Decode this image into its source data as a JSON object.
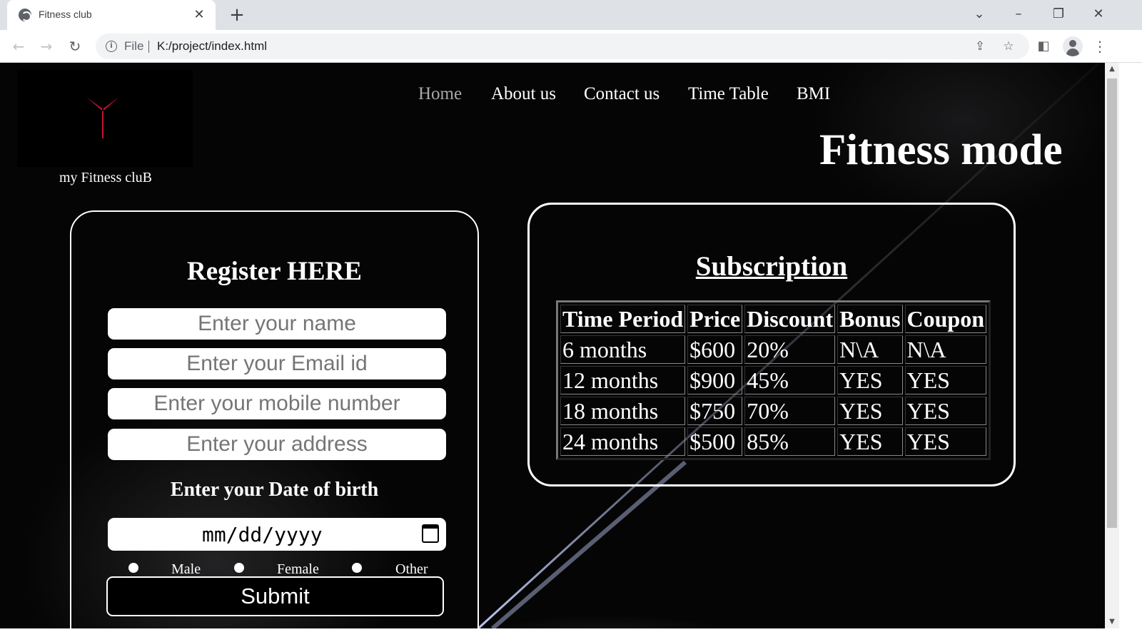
{
  "browser": {
    "tab_title": "Fitness club",
    "tab_close": "✕",
    "new_tab": "+",
    "url_scheme": "File",
    "url": "K:/project/index.html",
    "icons": [
      "globe-icon",
      "back-icon",
      "forward-icon",
      "reload-icon",
      "info-icon",
      "share-icon",
      "star-icon",
      "side-panel-icon",
      "profile-icon",
      "menu-icon"
    ]
  },
  "site": {
    "tagline": "my Fitness cluB",
    "nav": [
      "Home",
      "About us",
      "Contact us",
      "Time Table",
      "BMI"
    ],
    "active_nav": "Home",
    "hero_title": "Fitness mode"
  },
  "register": {
    "heading": "Register HERE",
    "name_placeholder": "Enter your name",
    "email_placeholder": "Enter your Email id",
    "mobile_placeholder": "Enter your mobile number",
    "address_placeholder": "Enter your address",
    "dob_label": "Enter your Date of birth",
    "dob_placeholder": "mm/dd/yyyy",
    "gender_options": [
      "Male",
      "Female",
      "Other"
    ],
    "submit_label": "Submit"
  },
  "subscription": {
    "heading": "Subscription",
    "columns": [
      "Time Period",
      "Price",
      "Discount",
      "Bonus",
      "Coupon"
    ],
    "rows": [
      [
        "6 months",
        "$600",
        "20%",
        "N\\A",
        "N\\A"
      ],
      [
        "12 months",
        "$900",
        "45%",
        "YES",
        "YES"
      ],
      [
        "18 months",
        "$750",
        "70%",
        "YES",
        "YES"
      ],
      [
        "24 months",
        "$500",
        "85%",
        "YES",
        "YES"
      ]
    ]
  },
  "colors": {
    "page_background": "#050505",
    "logo_accent": "#c8102e",
    "active_nav": "#a8a8a8",
    "text": "#ffffff"
  }
}
